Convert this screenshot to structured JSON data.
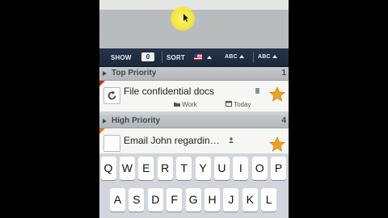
{
  "toolbar": {
    "show_label": "SHOW",
    "show_count": "0",
    "sort_label": "SORT",
    "sort_abc_1": "ABC",
    "sort_abc_2": "ABC",
    "accent": "#1c2839"
  },
  "sections": [
    {
      "title": "Top Priority",
      "count": "1"
    },
    {
      "title": "High Priority",
      "count": "4"
    }
  ],
  "tasks": [
    {
      "title": "File confidential docs",
      "folder": "Work",
      "due": "Today",
      "priority_color": "#c82d21",
      "star_color": "#f2a11b"
    },
    {
      "title": "Email John regardin…"
    }
  ],
  "keyboard": {
    "row1": [
      "Q",
      "W",
      "E",
      "R",
      "T",
      "Y",
      "U",
      "I",
      "O",
      "P"
    ],
    "row2": [
      "A",
      "S",
      "D",
      "F",
      "G",
      "H",
      "J",
      "K",
      "L"
    ]
  },
  "icons": [
    "repeat-icon",
    "note-icon",
    "star-icon",
    "folder-icon",
    "calendar-icon",
    "flag-icon",
    "person-icon"
  ]
}
